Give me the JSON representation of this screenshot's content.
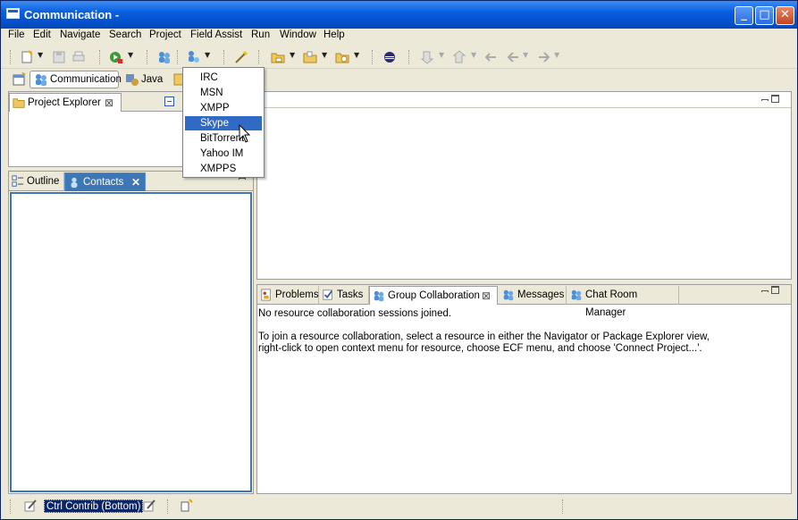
{
  "window": {
    "title": "Communication -"
  },
  "menubar": [
    "File",
    "Edit",
    "Navigate",
    "Search",
    "Project",
    "Field Assist",
    "Run",
    "Window",
    "Help"
  ],
  "perspectives": {
    "active": "Communication",
    "other": "Java"
  },
  "project_explorer": {
    "tab_label": "Project Explorer"
  },
  "left_views": {
    "outline_label": "Outline",
    "contacts_label": "Contacts"
  },
  "bottom_views": {
    "tabs": [
      "Problems",
      "Tasks",
      "Group Collaboration",
      "Messages",
      "Chat Room Manager"
    ],
    "active": "Group Collaboration",
    "message_line1": "No resource collaboration sessions joined.",
    "message_line2": "To join a resource collaboration, select a resource in either the Navigator or Package Explorer view,",
    "message_line3": "right-click to open context menu for resource, choose ECF menu, and choose 'Connect Project...'."
  },
  "connect_menu": {
    "items": [
      "IRC",
      "MSN",
      "XMPP",
      "Skype",
      "BitTorrent",
      "Yahoo IM",
      "XMPPS"
    ],
    "selected": "Skype"
  },
  "statusbar": {
    "trim_label": "Ctrl Contrib (Bottom)"
  },
  "colors": {
    "title_blue": "#0453d0",
    "selection": "#316ac5",
    "status_highlight": "#0a246a"
  }
}
